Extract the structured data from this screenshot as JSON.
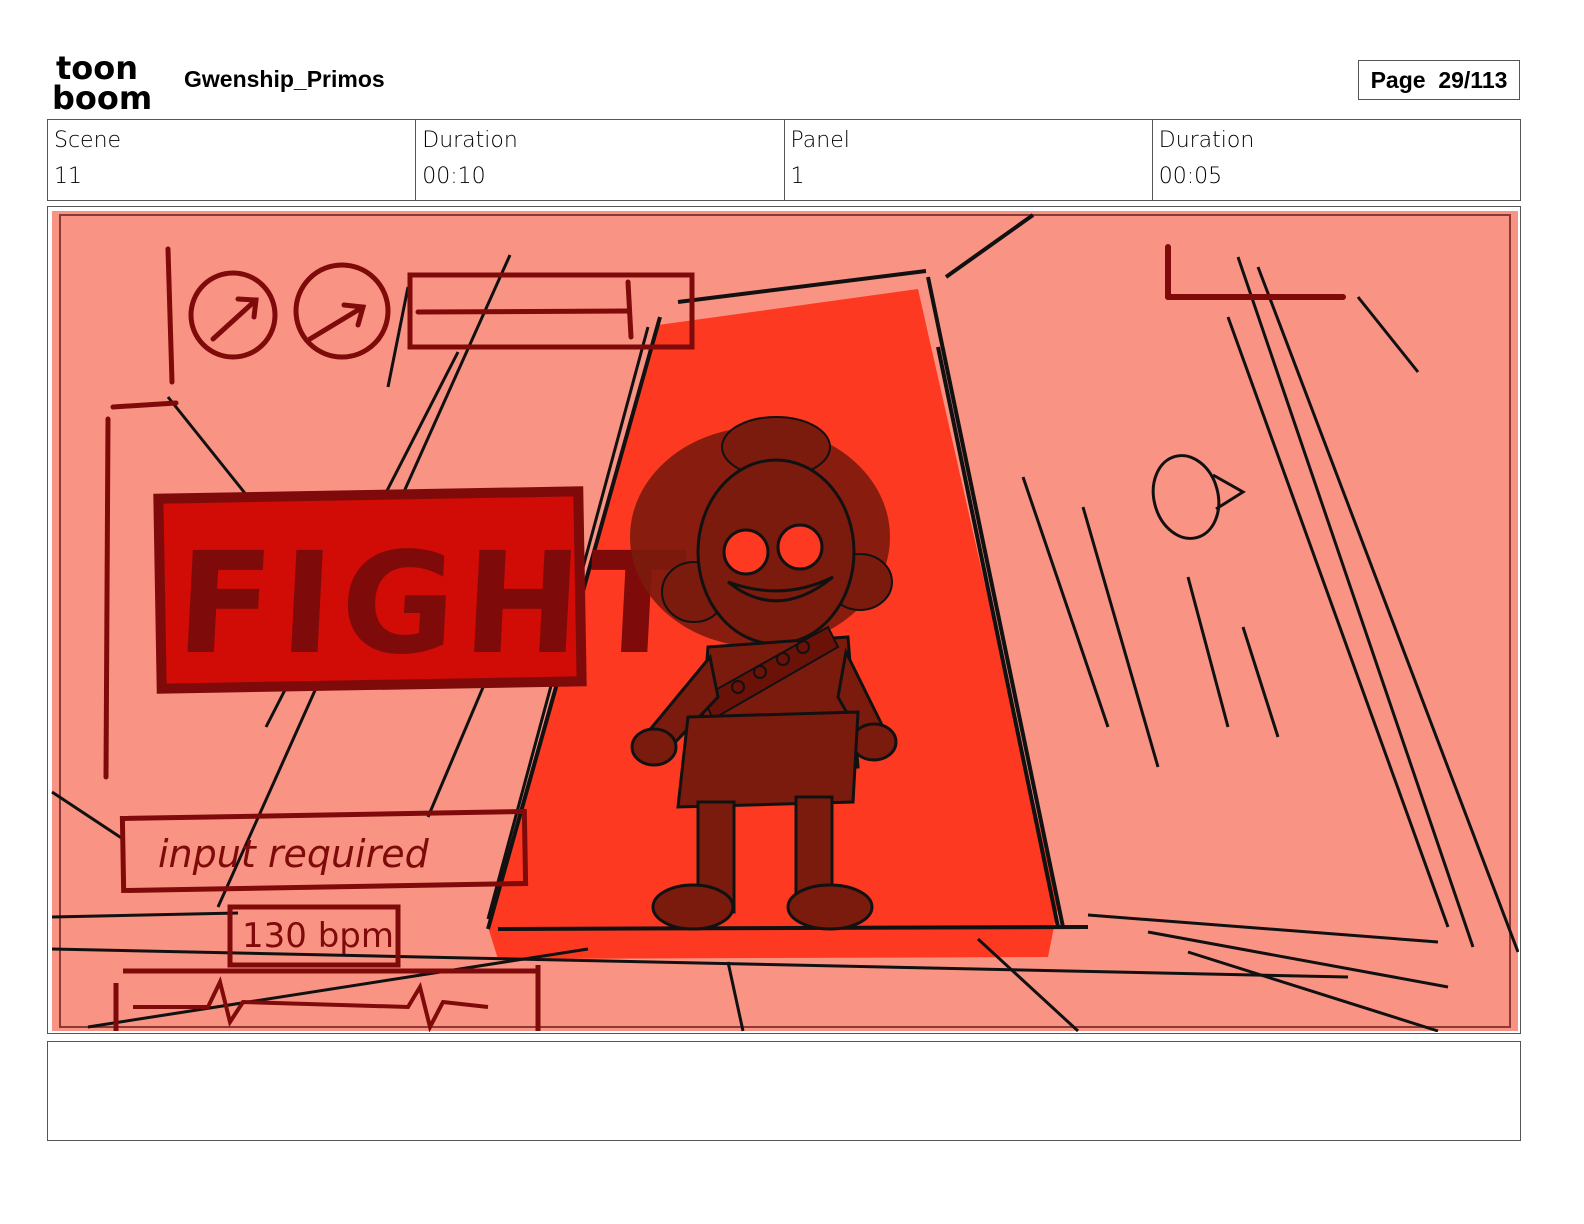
{
  "header": {
    "logo_text_top": "toon",
    "logo_text_bottom": "boom",
    "project_title": "Gwenship_Primos",
    "page_label": "Page  29/113"
  },
  "info": {
    "scene_label": "Scene",
    "scene_value": "11",
    "scene_duration_label": "Duration",
    "scene_duration_value": "00:10",
    "panel_label": "Panel",
    "panel_value": "1",
    "panel_duration_label": "Duration",
    "panel_duration_value": "00:05"
  },
  "panel": {
    "fight_text": "FIGHT",
    "input_text": "input required",
    "bpm_text": "130 bpm",
    "colors": {
      "background": "#f99484",
      "spotlight": "#fd3a21",
      "fight_box": "#d10b05",
      "ink_dark_red": "#7e0a0a",
      "character": "#7b1b0d",
      "line": "#111111"
    }
  },
  "caption": {
    "text": ""
  }
}
